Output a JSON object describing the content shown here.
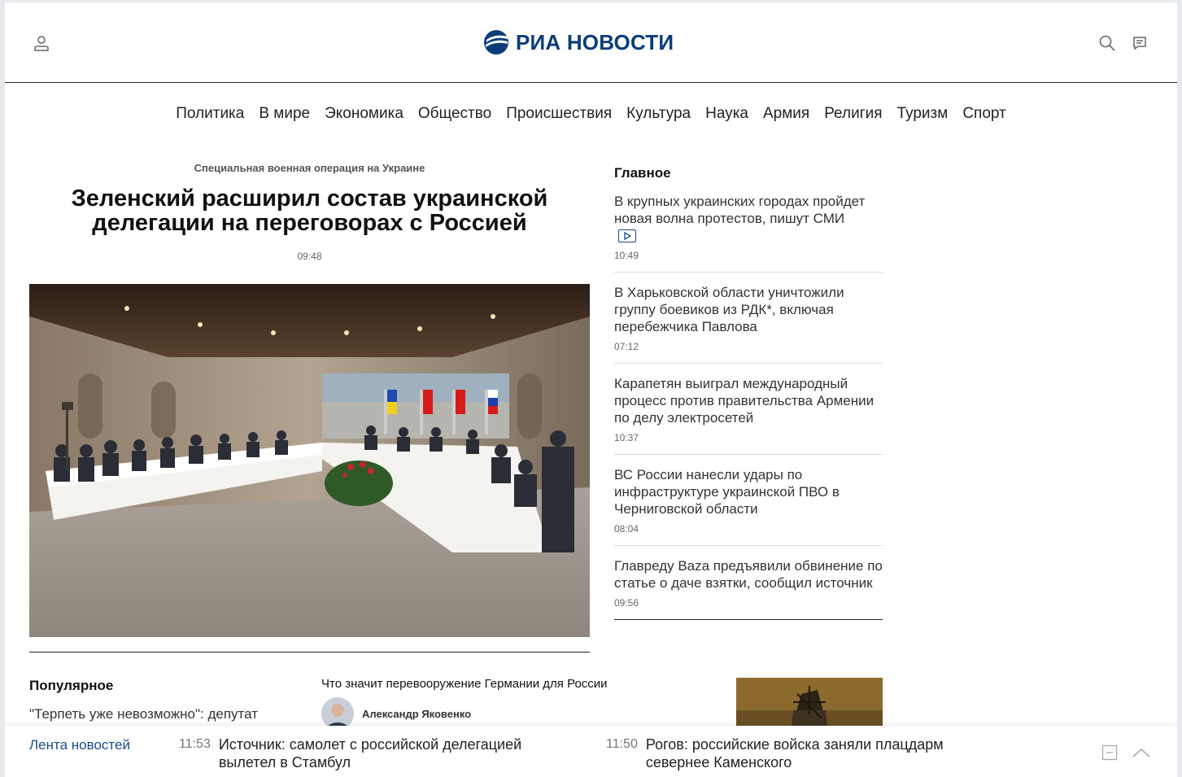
{
  "header": {
    "logo_text": "РИА НОВОСТИ",
    "brand_color": "#0a3d7a",
    "icons": {
      "profile": "user-icon",
      "search": "search-icon",
      "comments": "chat-icon"
    }
  },
  "nav": {
    "items": [
      "Политика",
      "В мире",
      "Экономика",
      "Общество",
      "Происшествия",
      "Культура",
      "Наука",
      "Армия",
      "Религия",
      "Туризм",
      "Спорт"
    ]
  },
  "lead": {
    "rubric": "Специальная военная операция на Украине",
    "title": "Зеленский расширил состав украинской делегации на переговорах с Россией",
    "time": "09:48"
  },
  "main": {
    "heading": "Главное",
    "items": [
      {
        "title": "В крупных украинских городах пройдет новая волна протестов, пишут СМИ",
        "time": "10:49",
        "video": true
      },
      {
        "title": "В Харьковской области уничтожили группу боевиков из РДК*, включая перебежчика Павлова",
        "time": "07:12"
      },
      {
        "title": "Карапетян выиграл международный процесс против правительства Армении по делу электросетей",
        "time": "10:37"
      },
      {
        "title": "ВС России нанесли удары по инфраструктуре украинской ПВО в Черниговской области",
        "time": "08:04"
      },
      {
        "title": "Главреду Baza предъявили обвинение по статье о даче взятки, сообщил источник",
        "time": "09:56"
      }
    ]
  },
  "popular": {
    "heading": "Популярное",
    "first": "\"Терпеть уже невозможно\": депутат"
  },
  "opinion": {
    "title": "Что значит перевооружение Германии для России",
    "author": "Александр Яковенко"
  },
  "ribbon": {
    "label": "Лента новостей",
    "items": [
      {
        "time": "11:53",
        "title": "Источник: самолет с российской делегацией вылетел в Стамбул"
      },
      {
        "time": "11:50",
        "title": "Рогов: российские войска заняли плацдарм севернее Каменского"
      }
    ]
  }
}
